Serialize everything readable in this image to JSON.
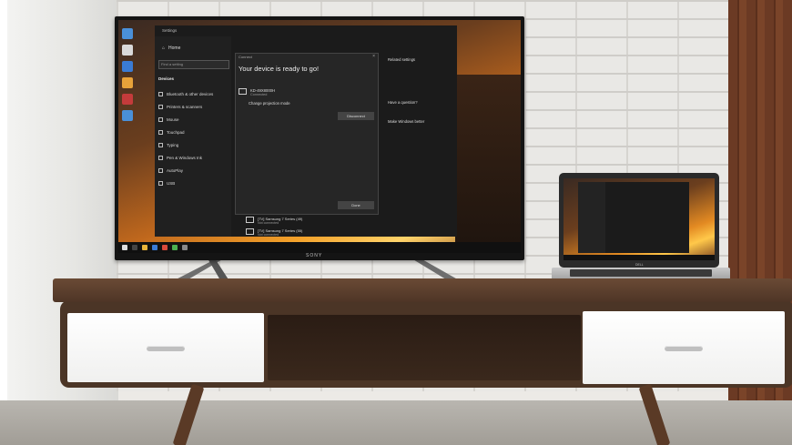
{
  "tv": {
    "brand": "SONY",
    "settings": {
      "window_title": "Settings",
      "home_label": "Home",
      "search_placeholder": "Find a setting",
      "section_label": "Devices",
      "nav_items": [
        "Bluetooth & other devices",
        "Printers & scanners",
        "Mouse",
        "Touchpad",
        "Typing",
        "Pen & Windows Ink",
        "AutoPlay",
        "USB"
      ],
      "right_panel": {
        "related_heading": "Related settings",
        "question_heading": "Have a question?",
        "better_heading": "Make Windows better"
      }
    },
    "dialog": {
      "title": "Connect",
      "heading": "Your device is ready to go!",
      "device_name": "KD-49X8000H",
      "device_status": "Connected",
      "projection_link": "Change projection mode",
      "disconnect_button": "Disconnect",
      "done_button": "Done"
    },
    "device_rows": [
      {
        "name": "[TV] Samsung 7 Series (49)",
        "status": "Not connected"
      },
      {
        "name": "[TV] Samsung 7 Series (55)",
        "status": "Not connected"
      }
    ]
  },
  "laptop": {
    "brand": "DELL"
  },
  "colors": {
    "console_wood": "#4b3526",
    "drawer_white": "#f4f4f3",
    "brick_wall": "#e9e8e5",
    "wood_panel": "#6b3a24"
  }
}
